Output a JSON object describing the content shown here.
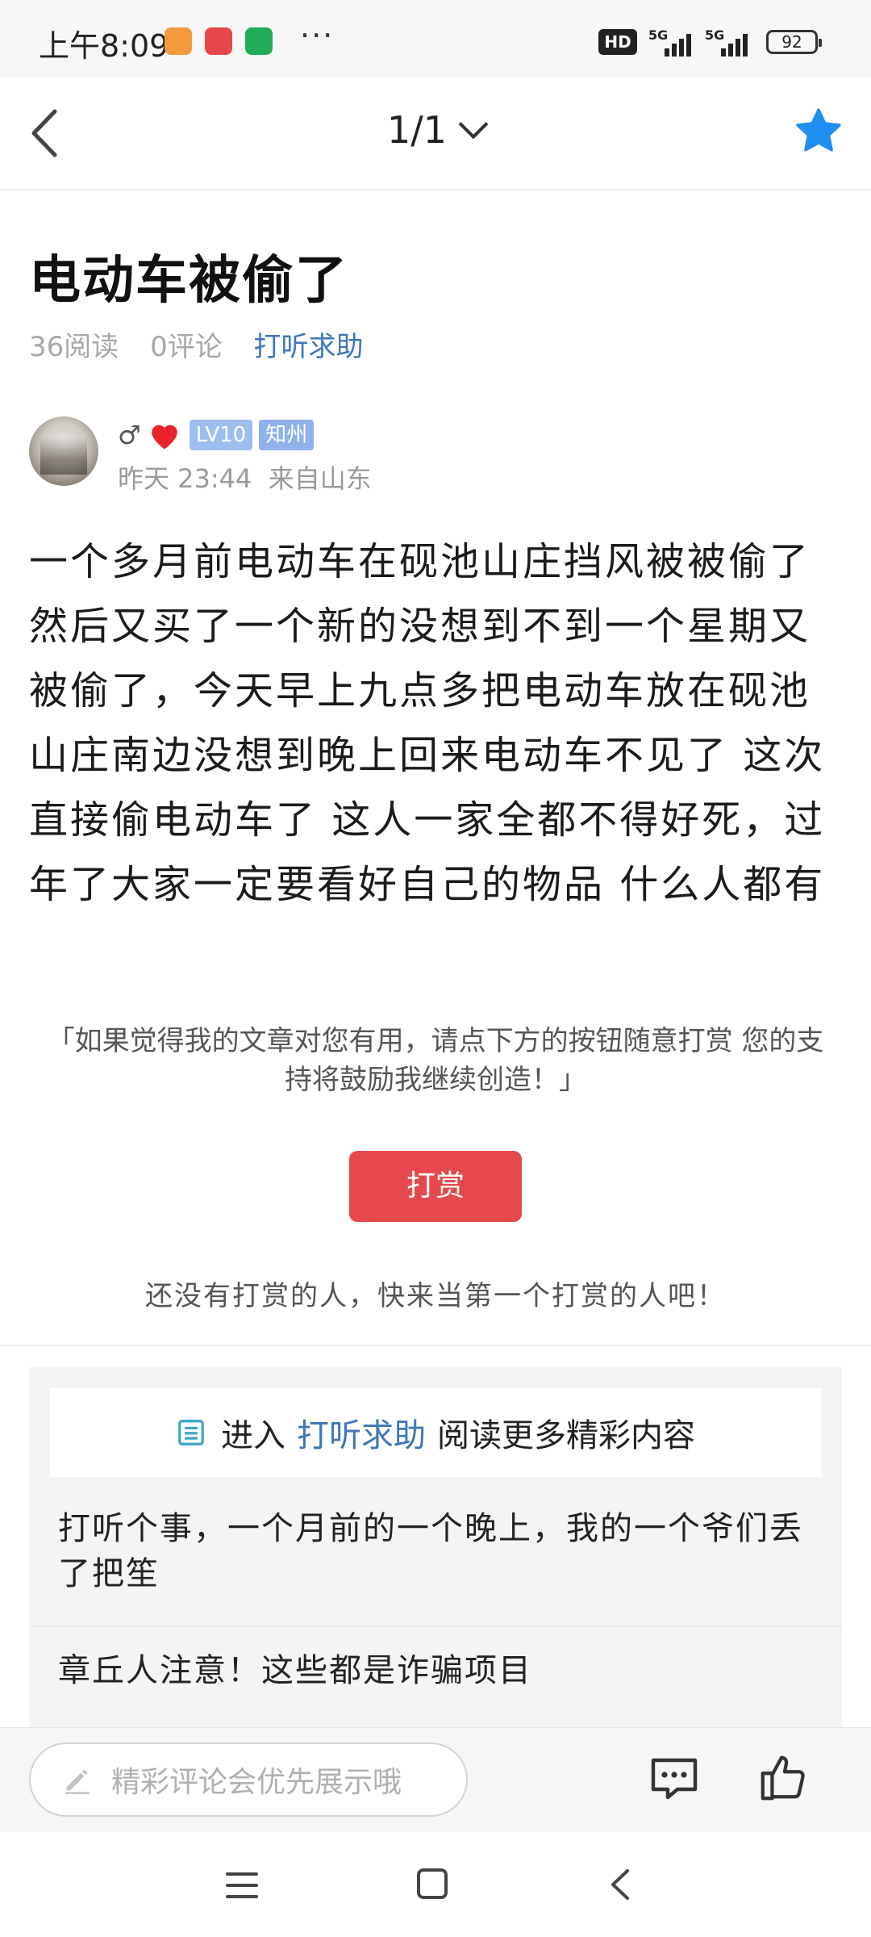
{
  "status_bar": {
    "time": "上午8:09",
    "more": "···",
    "hd": "HD",
    "signal1": "5G",
    "signal2": "5G",
    "battery": "92",
    "colors": {
      "app1": "#f39a3c",
      "app2": "#e8474a",
      "app3": "#1fae57"
    }
  },
  "nav": {
    "page_indicator": "1/1",
    "back_icon": "chevron-left-icon",
    "dropdown_icon": "chevron-down-icon",
    "favorite_icon": "star-icon",
    "star_color": "#1f8ef1"
  },
  "post": {
    "title": "电动车被偷了",
    "reads": "36阅读",
    "comments": "0评论",
    "category": "打听求助",
    "author": {
      "gender": "♂",
      "level": "LV10",
      "badge": "知州",
      "time": "昨天 23:44",
      "location": "来自山东"
    },
    "content": "一个多月前电动车在砚池山庄挡风被被偷了然后又买了一个新的没想到不到一个星期又被偷了，今天早上九点多把电动车放在砚池山庄南边没想到晚上回来电动车不见了 这次直接偷电动车了 这人一家全都不得好死，过年了大家一定要看好自己的物品 什么人都有"
  },
  "reward": {
    "text": "「如果觉得我的文章对您有用，请点下方的按钮随意打赏 您的支持将鼓励我继续创造！」",
    "button": "打赏",
    "empty": "还没有打赏的人，快来当第一个打赏的人吧！",
    "button_color": "#e5484d"
  },
  "more": {
    "prefix": "进入",
    "link": "打听求助",
    "suffix": "阅读更多精彩内容",
    "items": [
      "打听个事，一个月前的一个晚上，我的一个爷们丢了把笙",
      "章丘人注意！这些都是诈骗项目"
    ]
  },
  "bottom": {
    "comment_placeholder": "精彩评论会优先展示哦",
    "edit_icon": "pencil-icon",
    "comment_icon": "comment-bubble-icon",
    "like_icon": "thumbs-up-icon"
  },
  "system_nav": {
    "menu_icon": "menu-icon",
    "home_icon": "home-square-icon",
    "back_icon": "back-triangle-icon"
  }
}
